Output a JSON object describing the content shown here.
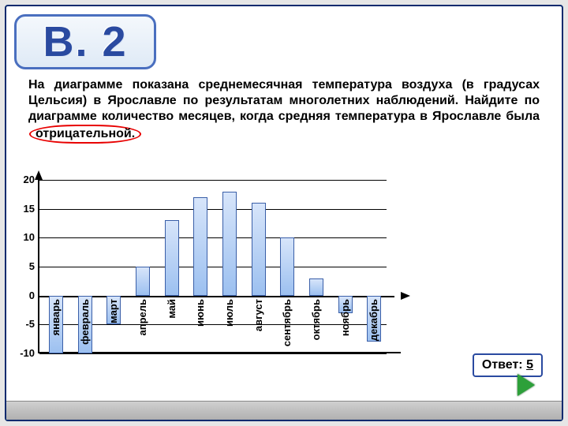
{
  "header": {
    "title": "В. 2"
  },
  "problem": {
    "text_before_emphasis": "На диаграмме показана среднемесячная температура воздуха (в градусах Цельсия) в Ярославле по результатам многолетних наблюдений. Найдите по диаграмме количество месяцев, когда средняя температура в Ярославле была ",
    "emphasized_word": "отрицательной."
  },
  "answer": {
    "label": "Ответ:",
    "value": "5"
  },
  "chart_data": {
    "type": "bar",
    "title": "",
    "xlabel": "",
    "ylabel": "",
    "ylim": [
      -10,
      20
    ],
    "yticks": [
      20,
      15,
      10,
      5,
      0,
      -5,
      -10
    ],
    "categories": [
      "январь",
      "февраль",
      "март",
      "апрель",
      "май",
      "июнь",
      "июль",
      "август",
      "сентябрь",
      "октябрь",
      "ноябрь",
      "декабрь"
    ],
    "values": [
      -10,
      -10,
      -5,
      5,
      13,
      17,
      18,
      16,
      10,
      3,
      -3,
      -8
    ]
  }
}
